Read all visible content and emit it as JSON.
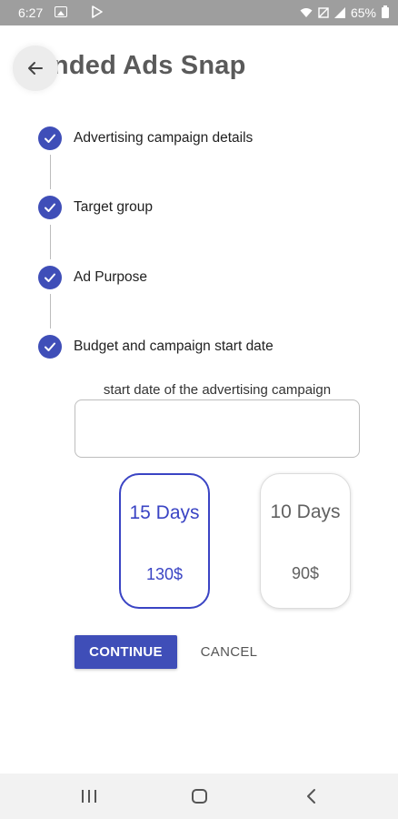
{
  "status_bar": {
    "time": "6:27",
    "battery": "65%"
  },
  "header": {
    "title": "unded Ads Snap"
  },
  "steps": [
    {
      "label": "Advertising campaign details",
      "completed": true
    },
    {
      "label": "Target group",
      "completed": true
    },
    {
      "label": "Ad Purpose",
      "completed": true
    },
    {
      "label": "Budget and campaign start date",
      "completed": true
    }
  ],
  "budget_form": {
    "start_date_caption": "start date of the advertising campaign",
    "start_date_value": "",
    "plans": [
      {
        "days": "15 Days",
        "price": "130$",
        "selected": true
      },
      {
        "days": "10 Days",
        "price": "90$",
        "selected": false
      }
    ]
  },
  "actions": {
    "continue_label": "CONTINUE",
    "cancel_label": "CANCEL"
  },
  "colors": {
    "accent": "#3f4eb8",
    "selected_card": "#3a44c4",
    "status_bar": "#9e9e9e"
  }
}
